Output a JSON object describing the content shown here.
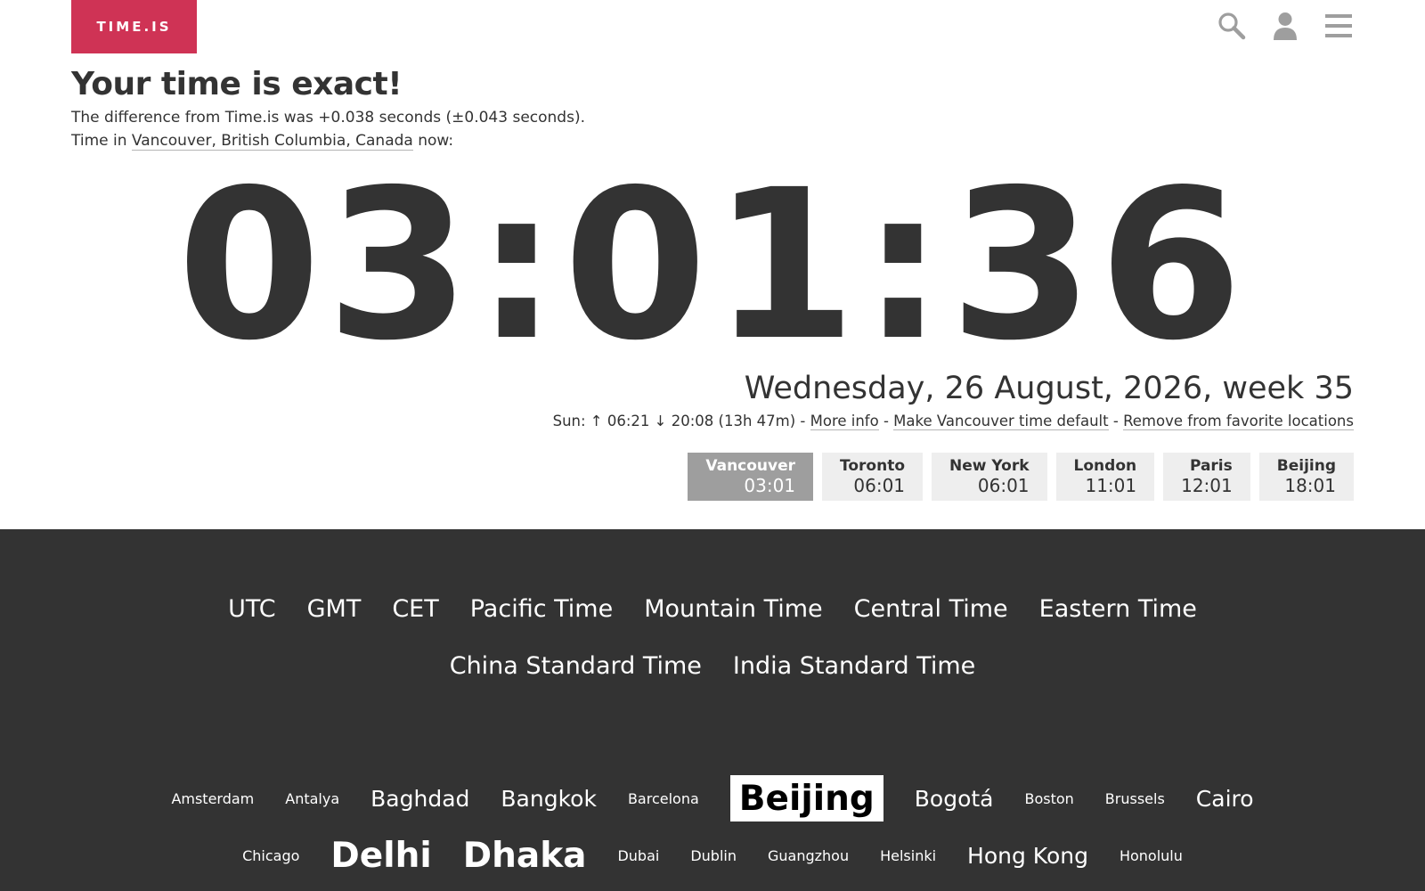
{
  "header": {
    "logo": "TIME.IS",
    "icons": [
      "search-icon",
      "user-icon",
      "menu-icon"
    ]
  },
  "intro": {
    "headline": "Your time is exact!",
    "difference": "The difference from Time.is was +0.038 seconds (±0.043 seconds).",
    "location_prefix": "Time in ",
    "location": "Vancouver, British Columbia, Canada",
    "location_suffix": " now:"
  },
  "clock": {
    "time": "03:01:36"
  },
  "date": {
    "text": "Wednesday, 26 August, 2026, week 35"
  },
  "sun": {
    "info": "Sun: ↑ 06:21 ↓ 20:08 (13h 47m) - ",
    "more_info": "More info",
    "sep1": " - ",
    "make_default": "Make Vancouver time default",
    "sep2": " - ",
    "remove_favorite": "Remove from favorite locations"
  },
  "city_tabs": [
    {
      "name": "Vancouver",
      "time": "03:01",
      "active": true
    },
    {
      "name": "Toronto",
      "time": "06:01"
    },
    {
      "name": "New York",
      "time": "06:01"
    },
    {
      "name": "London",
      "time": "11:01"
    },
    {
      "name": "Paris",
      "time": "12:01"
    },
    {
      "name": "Beijing",
      "time": "18:01"
    }
  ],
  "zones": [
    "UTC",
    "GMT",
    "CET",
    "Pacific Time",
    "Mountain Time",
    "Central Time",
    "Eastern Time",
    "China Standard Time",
    "India Standard Time"
  ],
  "cities": [
    {
      "name": "Amsterdam",
      "size": "s"
    },
    {
      "name": "Antalya",
      "size": "s"
    },
    {
      "name": "Baghdad",
      "size": "m"
    },
    {
      "name": "Bangkok",
      "size": "m"
    },
    {
      "name": "Barcelona",
      "size": "s"
    },
    {
      "name": "Beijing",
      "size": "l",
      "highlight": true
    },
    {
      "name": "Bogotá",
      "size": "m"
    },
    {
      "name": "Boston",
      "size": "s"
    },
    {
      "name": "Brussels",
      "size": "s"
    },
    {
      "name": "Cairo",
      "size": "m"
    },
    {
      "name": "Chicago",
      "size": "s"
    },
    {
      "name": "Delhi",
      "size": "l"
    },
    {
      "name": "Dhaka",
      "size": "l"
    },
    {
      "name": "Dubai",
      "size": "s"
    },
    {
      "name": "Dublin",
      "size": "s"
    },
    {
      "name": "Guangzhou",
      "size": "s"
    },
    {
      "name": "Helsinki",
      "size": "s"
    },
    {
      "name": "Hong Kong",
      "size": "m"
    },
    {
      "name": "Honolulu",
      "size": "s"
    }
  ],
  "colors": {
    "brand": "#cf3355",
    "text": "#333333",
    "dark_bg": "#333333",
    "tab_bg": "#eeeeee",
    "tab_active_bg": "#9e9e9e"
  }
}
